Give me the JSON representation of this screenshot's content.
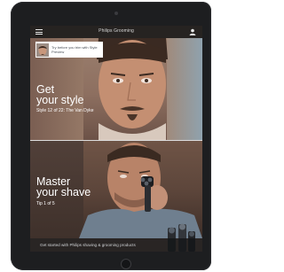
{
  "header": {
    "title": "Philips Grooming",
    "menu_icon": "hamburger-menu-icon",
    "user_icon": "user-icon"
  },
  "style_panel": {
    "try_card_text": "Try before you trim with Style Preview",
    "headline_line1": "Get",
    "headline_line2": "your style",
    "subtitle": "Style 12 of 22: The Van Dyke"
  },
  "shave_panel": {
    "headline_line1": "Master",
    "headline_line2": "your shave",
    "subtitle": "Tip 1 of 5"
  },
  "footer": {
    "text": "Get started with Philips shaving & grooming products"
  },
  "colors": {
    "device": "#1d1e20",
    "header_bar": "#141618",
    "text_primary": "#ffffff"
  }
}
